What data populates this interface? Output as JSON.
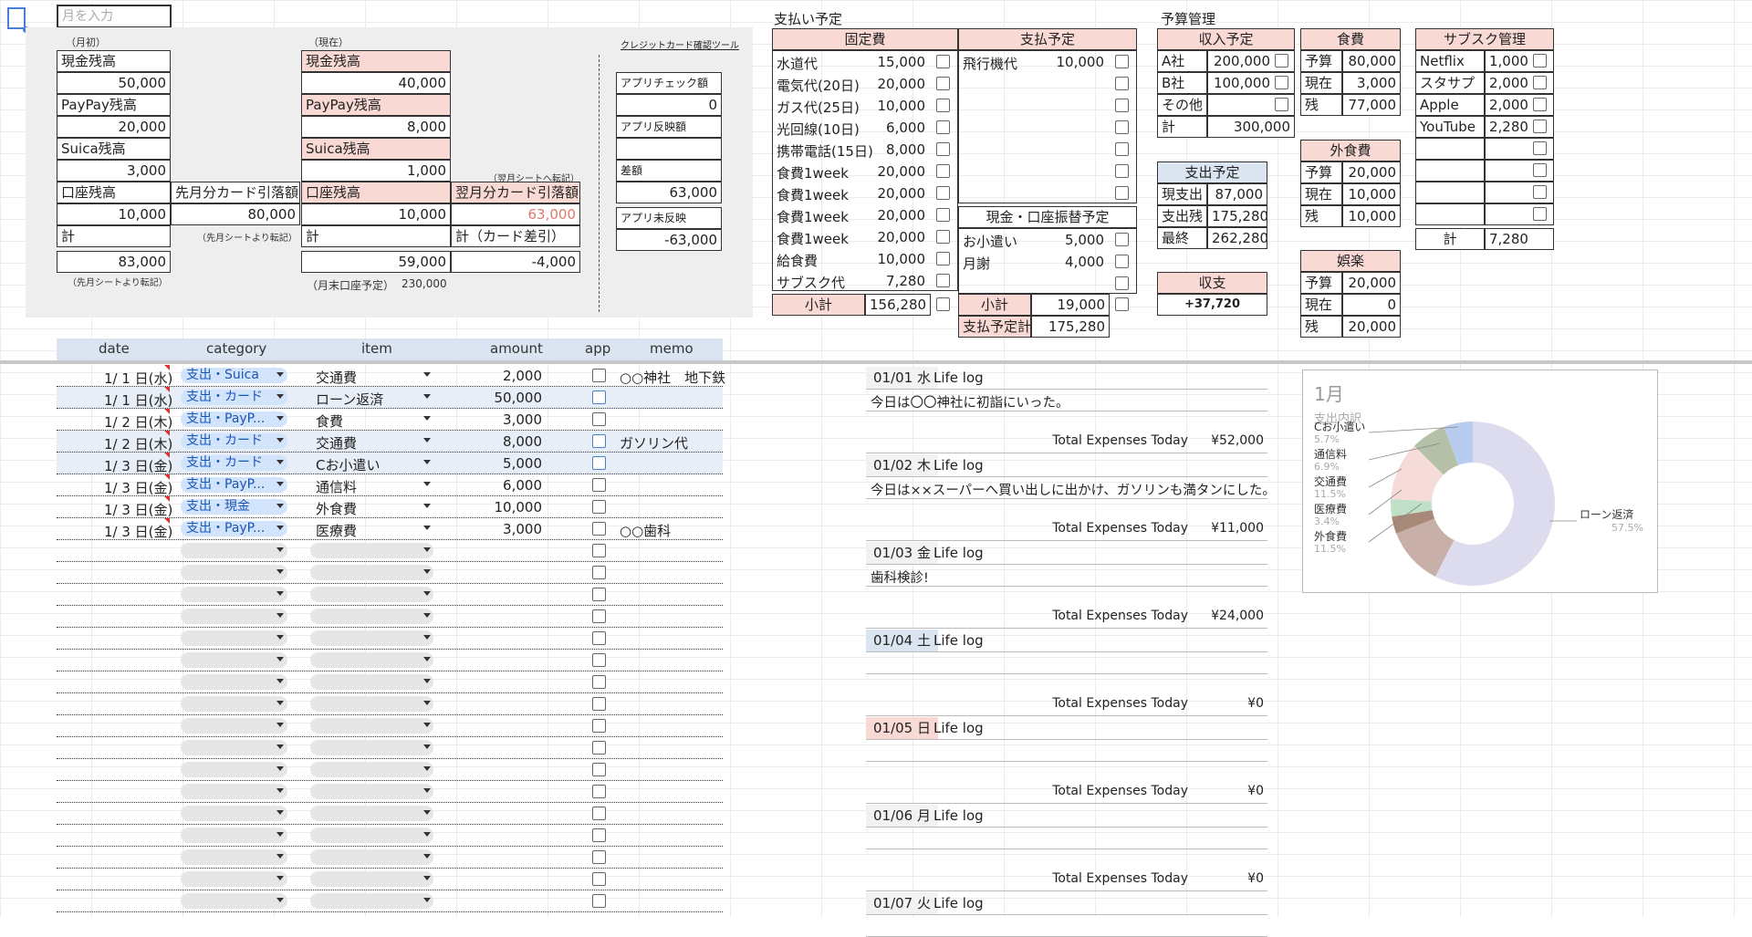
{
  "month_input_placeholder": "月を入力",
  "start_panel": {
    "label": "（月初）",
    "cash_label": "現金残高",
    "cash": "50,000",
    "paypay_label": "PayPay残高",
    "paypay": "20,000",
    "suica_label": "Suica残高",
    "suica": "3,000",
    "bank_label": "口座残高",
    "bank": "10,000",
    "card_label": "先月分カード引落額",
    "card": "80,000",
    "card_note": "（先月シートより転記）",
    "total_label": "計",
    "total": "83,000",
    "total_note": "（先月シートより転記）"
  },
  "current_panel": {
    "label": "（現在）",
    "cash_label": "現金残高",
    "cash": "40,000",
    "paypay_label": "PayPay残高",
    "paypay": "8,000",
    "suica_label": "Suica残高",
    "suica": "1,000",
    "transfer_note": "（翌月シートへ転記）",
    "bank_label": "口座残高",
    "bank": "10,000",
    "next_card_label": "翌月分カード引落額",
    "next_card": "63,000",
    "total_label": "計",
    "total": "59,000",
    "total_card_label": "計（カード差引）",
    "total_card": "-4,000",
    "eom_label": "（月末口座予定）",
    "eom": "230,000"
  },
  "credit_tool": {
    "title": "クレジットカード確認ツール",
    "app_check_label": "アプリチェック額",
    "app_check": "0",
    "app_reflect_label": "アプリ反映額",
    "app_reflect": "",
    "diff_label": "差額",
    "diff": "63,000",
    "unreflected_label": "アプリ未反映",
    "unreflected": "-63,000"
  },
  "payment_schedule": {
    "title": "支払い予定",
    "fixed_header": "固定費",
    "fixed": [
      {
        "name": "水道代",
        "amount": "15,000"
      },
      {
        "name": "電気代(20日)",
        "amount": "20,000"
      },
      {
        "name": "ガス代(25日)",
        "amount": "10,000"
      },
      {
        "name": "光回線(10日)",
        "amount": "6,000"
      },
      {
        "name": "携帯電話(15日)",
        "amount": "8,000"
      },
      {
        "name": "食費1week",
        "amount": "20,000"
      },
      {
        "name": "食費1week",
        "amount": "20,000"
      },
      {
        "name": "食費1week",
        "amount": "20,000"
      },
      {
        "name": "食費1week",
        "amount": "20,000"
      },
      {
        "name": "給食費",
        "amount": "10,000"
      },
      {
        "name": "サブスク代",
        "amount": "7,280"
      }
    ],
    "fixed_subtotal_label": "小計",
    "fixed_subtotal": "156,280",
    "planned_header": "支払予定",
    "planned": [
      {
        "name": "飛行機代",
        "amount": "10,000"
      }
    ],
    "cash_header": "現金・口座振替予定",
    "cash_items": [
      {
        "name": "お小遣い",
        "amount": "5,000"
      },
      {
        "name": "月謝",
        "amount": "4,000"
      }
    ],
    "cash_subtotal_label": "小計",
    "cash_subtotal": "19,000",
    "planned_total_label": "支払予定計",
    "planned_total": "175,280"
  },
  "budget": {
    "title": "予算管理",
    "income_header": "収入予定",
    "income": [
      {
        "name": "A社",
        "amount": "200,000"
      },
      {
        "name": "B社",
        "amount": "100,000"
      },
      {
        "name": "その他",
        "amount": ""
      }
    ],
    "income_total_label": "計",
    "income_total": "300,000",
    "expense_header": "支出予定",
    "expense": [
      {
        "name": "現支出",
        "amount": "87,000"
      },
      {
        "name": "支出残",
        "amount": "175,280"
      },
      {
        "name": "最終",
        "amount": "262,280"
      }
    ],
    "balance_header": "収支",
    "balance": "+37,720",
    "food": {
      "header": "食費",
      "rows": [
        {
          "k": "予算",
          "v": "80,000"
        },
        {
          "k": "現在",
          "v": "3,000"
        },
        {
          "k": "残",
          "v": "77,000"
        }
      ]
    },
    "eating_out": {
      "header": "外食費",
      "rows": [
        {
          "k": "予算",
          "v": "20,000"
        },
        {
          "k": "現在",
          "v": "10,000"
        },
        {
          "k": "残",
          "v": "10,000"
        }
      ]
    },
    "entertainment": {
      "header": "娯楽",
      "rows": [
        {
          "k": "予算",
          "v": "20,000"
        },
        {
          "k": "現在",
          "v": "0"
        },
        {
          "k": "残",
          "v": "20,000"
        }
      ]
    },
    "subs": {
      "header": "サブスク管理",
      "rows": [
        {
          "name": "Netflix",
          "amount": "1,000"
        },
        {
          "name": "スタサプ",
          "amount": "2,000"
        },
        {
          "name": "Apple",
          "amount": "2,000"
        },
        {
          "name": "YouTube",
          "amount": "2,280"
        }
      ],
      "total_label": "計",
      "total": "7,280"
    }
  },
  "ledger": {
    "columns": [
      "date",
      "category",
      "item",
      "amount",
      "app",
      "memo"
    ],
    "rows": [
      {
        "date": "1/ 1 日(水)",
        "category": "支出・Suica",
        "item": "交通費",
        "amount": "2,000",
        "memo": "○○神社　地下鉄",
        "hl": false
      },
      {
        "date": "1/ 1 日(水)",
        "category": "支出・カード",
        "item": "ローン返済",
        "amount": "50,000",
        "memo": "",
        "hl": true
      },
      {
        "date": "1/ 2 日(木)",
        "category": "支出・PayP...",
        "item": "食費",
        "amount": "3,000",
        "memo": "",
        "hl": false
      },
      {
        "date": "1/ 2 日(木)",
        "category": "支出・カード",
        "item": "交通費",
        "amount": "8,000",
        "memo": "ガソリン代",
        "hl": true
      },
      {
        "date": "1/ 3 日(金)",
        "category": "支出・カード",
        "item": "Cお小遣い",
        "amount": "5,000",
        "memo": "",
        "hl": true
      },
      {
        "date": "1/ 3 日(金)",
        "category": "支出・PayP...",
        "item": "通信料",
        "amount": "6,000",
        "memo": "",
        "hl": false
      },
      {
        "date": "1/ 3 日(金)",
        "category": "支出・現金",
        "item": "外食費",
        "amount": "10,000",
        "memo": "",
        "hl": false
      },
      {
        "date": "1/ 3 日(金)",
        "category": "支出・PayP...",
        "item": "医療費",
        "amount": "3,000",
        "memo": "○○歯科",
        "hl": false
      }
    ],
    "empty_rows": 17
  },
  "life_log": [
    {
      "date": "01/01 水",
      "title": "Life log",
      "text": "今日は〇〇神社に初詣にいった。",
      "total_label": "Total Expenses Today",
      "total": "¥52,000",
      "tint": "#f2f2f2"
    },
    {
      "date": "01/02 木",
      "title": "Life log",
      "text": "今日は××スーパーへ買い出しに出かけ、ガソリンも満タンにした。",
      "total_label": "Total Expenses Today",
      "total": "¥11,000",
      "tint": "#f2f2f2"
    },
    {
      "date": "01/03 金",
      "title": "Life log",
      "text": "歯科検診!",
      "total_label": "Total Expenses Today",
      "total": "¥24,000",
      "tint": "#f2f2f2"
    },
    {
      "date": "01/04 土",
      "title": "Life log",
      "text": "",
      "total_label": "Total Expenses Today",
      "total": "¥0",
      "tint": "#dbe5f1"
    },
    {
      "date": "01/05 日",
      "title": "Life log",
      "text": "",
      "total_label": "Total Expenses Today",
      "total": "¥0",
      "tint": "#f9d9d4"
    },
    {
      "date": "01/06 月",
      "title": "Life log",
      "text": "",
      "total_label": "Total Expenses Today",
      "total": "¥0",
      "tint": "#f2f2f2"
    },
    {
      "date": "01/07 火",
      "title": "Life log",
      "text": "",
      "total_label": "",
      "total": "",
      "tint": "#f2f2f2"
    }
  ],
  "chart_data": {
    "type": "pie",
    "title": "1月",
    "subtitle": "支出内訳",
    "donut": true,
    "slices": [
      {
        "label": "ローン返済",
        "value": 57.5,
        "color": "#dcdcee"
      },
      {
        "label": "外食費",
        "value": 11.5,
        "color": "#c8b0a8"
      },
      {
        "label": "",
        "value": 3.4,
        "color": "#a88878"
      },
      {
        "label": "医療費",
        "value": 3.4,
        "color": "#c0e0c8"
      },
      {
        "label": "交通費",
        "value": 11.5,
        "color": "#f6dcd8"
      },
      {
        "label": "通信料",
        "value": 6.9,
        "color": "#b4c0a8"
      },
      {
        "label": "Cお小遣い",
        "value": 5.7,
        "color": "#b8ccf0"
      }
    ],
    "labels_shown": [
      {
        "label": "Cお小遣い",
        "pct": "5.7%"
      },
      {
        "label": "通信料",
        "pct": "6.9%"
      },
      {
        "label": "交通費",
        "pct": "11.5%"
      },
      {
        "label": "医療費",
        "pct": "3.4%"
      },
      {
        "label": "外食費",
        "pct": "11.5%"
      },
      {
        "label": "ローン返済",
        "pct": "57.5%"
      }
    ]
  }
}
